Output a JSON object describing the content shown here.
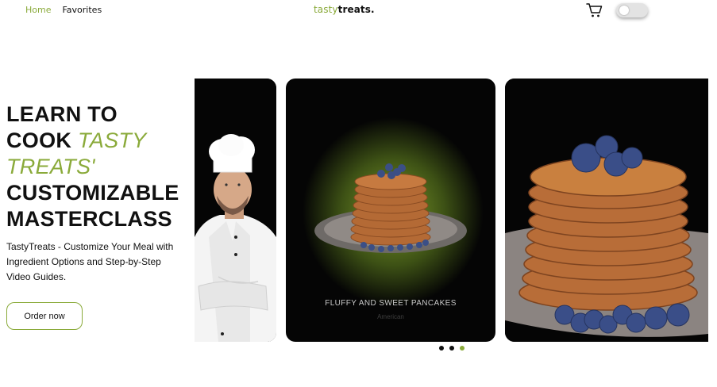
{
  "nav": {
    "home_label": "Home",
    "favorites_label": "Favorites"
  },
  "logo": {
    "accent": "tasty",
    "main": "treats."
  },
  "hero": {
    "title_line1": "LEARN TO",
    "title_line2_plain": "COOK ",
    "title_line2_accent": "TASTY",
    "title_line3_accent": "TREATS'",
    "title_line4": "CUSTOMIZABLE",
    "title_line5": "MASTERCLASS",
    "description": "TastyTreats - Customize Your Meal with Ingredient Options and Step-by-Step Video Guides.",
    "order_button": "Order now"
  },
  "carousel": {
    "center_card": {
      "title": "FLUFFY AND SWEET PANCAKES",
      "cuisine": "American"
    },
    "dots": 3,
    "active_dot": 2
  },
  "colors": {
    "accent": "#8aaa3a",
    "card_bg": "#050505"
  },
  "icons": [
    "cart-icon",
    "theme-toggle"
  ]
}
